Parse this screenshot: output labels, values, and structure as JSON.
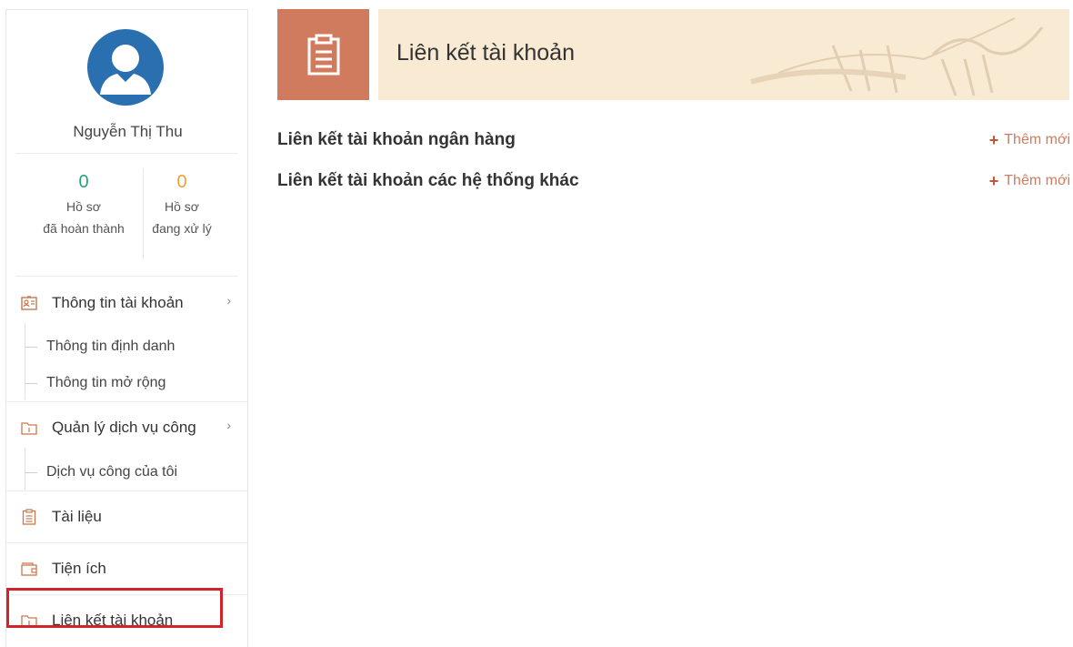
{
  "profile": {
    "name": "Nguyễn Thị Thu",
    "completed_count": "0",
    "completed_label_1": "Hồ sơ",
    "completed_label_2": "đã hoàn thành",
    "processing_count": "0",
    "processing_label_1": "Hồ sơ",
    "processing_label_2": "đang xử lý",
    "colors": {
      "completed": "#27a37a",
      "processing": "#f0a233"
    }
  },
  "sidebar": {
    "account_info": {
      "label": "Thông tin tài khoản",
      "icon": "id-card-icon",
      "children": [
        "Thông tin định danh",
        "Thông tin mở rộng"
      ]
    },
    "public_services": {
      "label": "Quản lý dịch vụ công",
      "icon": "folder-icon",
      "children": [
        "Dịch vụ công của tôi"
      ]
    },
    "documents": {
      "label": "Tài liệu",
      "icon": "clipboard-icon"
    },
    "utilities": {
      "label": "Tiện ích",
      "icon": "wallet-icon"
    },
    "account_link": {
      "label": "Liên kết tài khoản",
      "icon": "folder-link-icon",
      "selected": true
    }
  },
  "main": {
    "title": "Liên kết tài khoản",
    "sections": [
      {
        "title": "Liên kết tài khoản ngân hàng",
        "action": "Thêm mới"
      },
      {
        "title": "Liên kết tài khoản các hệ thống khác",
        "action": "Thêm mới"
      }
    ]
  },
  "colors": {
    "accent": "#d07b5e",
    "banner": "#f8ead3",
    "highlight": "#d0232a",
    "avatar": "#2a6fb0"
  }
}
